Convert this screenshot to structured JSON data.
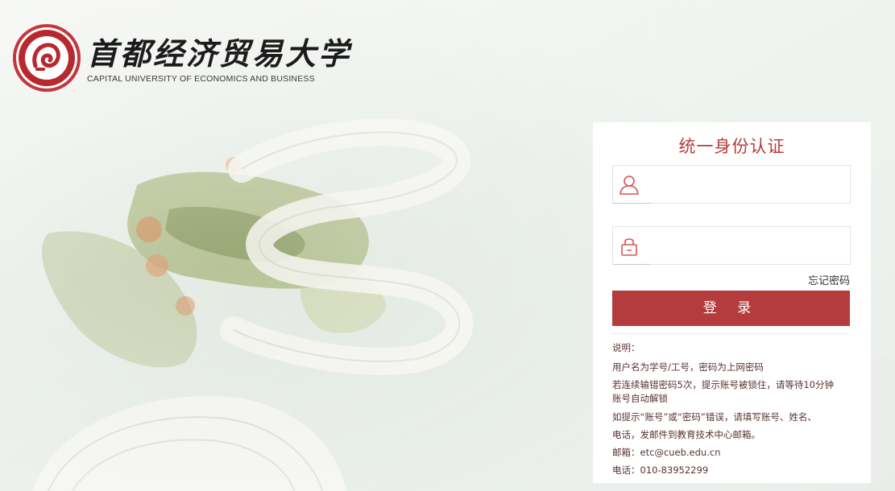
{
  "header": {
    "name_cn": "首都经济贸易大学",
    "name_en": "CAPITAL UNIVERSITY OF ECONOMICS AND BUSINESS",
    "emblem_icon": "university-emblem-icon"
  },
  "login": {
    "title": "统一身份认证",
    "username": {
      "icon": "user-icon",
      "value": "",
      "placeholder": ""
    },
    "password": {
      "icon": "lock-icon",
      "value": "",
      "placeholder": ""
    },
    "forgot_label": "忘记密码",
    "submit_label": "登 录",
    "notes": {
      "heading": "说明：",
      "line1": "用户名为学号/工号，密码为上网密码",
      "line2a": "若连续输错密码5次，提示账号被锁住，请等待10分钟",
      "line2b": "账号自动解锁",
      "line3a": "如提示“账号”或“密码”错误，请填写账号、姓名、",
      "line3b": "电话，发邮件到教育技术中心邮箱。",
      "email": "邮箱：etc@cueb.edu.cn",
      "phone": "电话：010-83952299"
    }
  },
  "colors": {
    "brand_red": "#b53c3d",
    "title_red": "#b63b3c",
    "emblem_red": "#b8282f"
  }
}
